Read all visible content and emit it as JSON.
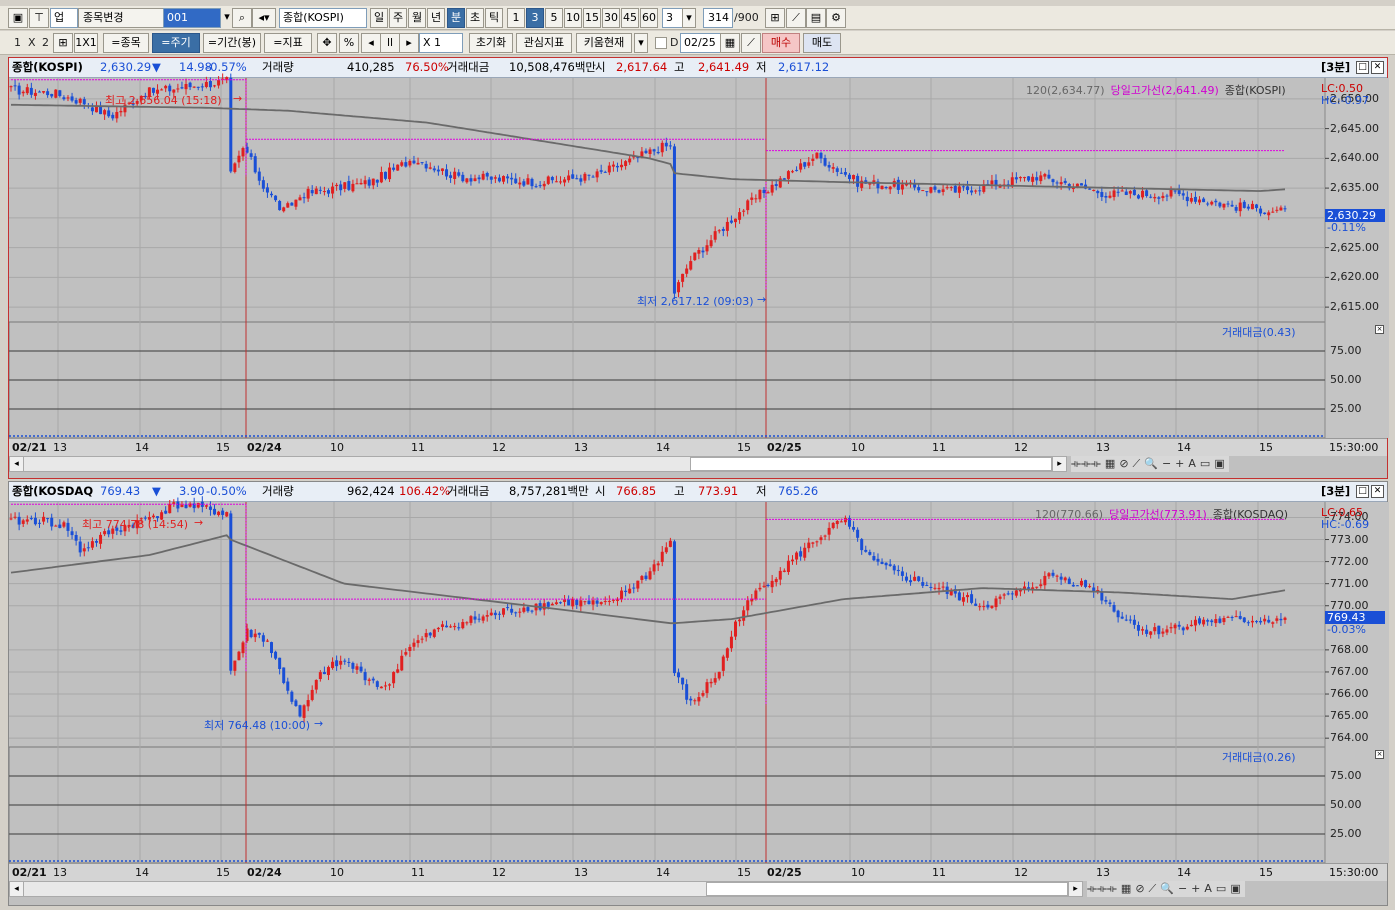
{
  "toolbar1": {
    "market": "업",
    "stock_change": "종목변경",
    "code": "001",
    "index_name": "종합(KOSPI)",
    "periods": [
      "일",
      "주",
      "월",
      "년",
      "분",
      "초",
      "틱"
    ],
    "intervals": [
      "1",
      "3",
      "5",
      "10",
      "15",
      "30",
      "45",
      "60"
    ],
    "interval_value": "3",
    "count": "314",
    "count_max": "/900"
  },
  "toolbar2": {
    "layout_1": "1",
    "layout_x": "X",
    "layout_2": "2",
    "layout_1x1": "1X1",
    "stock_btn": "=종목",
    "period_btn": "=주기",
    "range_btn": "=기간(봉)",
    "indicator_btn": "=지표",
    "percent": "%",
    "zoom": "X 1",
    "reset": "초기화",
    "interest": "관심지표",
    "kiwoom": "키움현재",
    "d_label": "D",
    "date": "02/25",
    "buy": "매수",
    "sell": "매도"
  },
  "colors": {
    "up": "#e02020",
    "down": "#1a4fd6",
    "ma": "#6a6a6a",
    "hiline": "#e000e0"
  },
  "charts": [
    {
      "title": "종합(KOSPI)",
      "price": "2,630.29",
      "arrow": "▼",
      "change": "14.98",
      "pct": "-0.57%",
      "vol_label": "거래량",
      "vol": "410,285",
      "vol_pct": "76.50%",
      "amt_label": "거래대금",
      "amt": "10,508,476백만",
      "open_label": "시",
      "open": "2,617.64",
      "high_label": "고",
      "high": "2,641.49",
      "low_label": "저",
      "low": "2,617.12",
      "interval_tag": "[3분]",
      "legend_ma": "120(2,634.77)",
      "legend_hi": "당일고가선(2,641.49)",
      "legend_name": "종합(KOSPI)",
      "lc": "LC:0.50",
      "hc": "HC:-0.97",
      "yticks": [
        "2,650.00",
        "2,645.00",
        "2,640.00",
        "2,635.00",
        "2,630.00",
        "2,625.00",
        "2,620.00",
        "2,615.00"
      ],
      "cur_price": "2,630.29",
      "cur_pct": "-0.11%",
      "max_label": "최고 2,656.04 (15:18)",
      "min_label": "최저 2,617.12 (09:03)",
      "sub_label": "거래대금(0.43)",
      "sub_ticks": [
        "75.00",
        "50.00",
        "25.00"
      ],
      "xlabels": [
        "02/21",
        "13",
        "14",
        "15",
        "02/24",
        "10",
        "11",
        "12",
        "13",
        "14",
        "15",
        "02/25",
        "10",
        "11",
        "12",
        "13",
        "14",
        "15"
      ],
      "time": "15:30:00"
    },
    {
      "title": "종합(KOSDAQ",
      "price": "769.43",
      "arrow": "▼",
      "change": "3.90",
      "pct": "-0.50%",
      "vol_label": "거래량",
      "vol": "962,424",
      "vol_pct": "106.42%",
      "amt_label": "거래대금",
      "amt": "8,757,281백만",
      "open_label": "시",
      "open": "766.85",
      "high_label": "고",
      "high": "773.91",
      "low_label": "저",
      "low": "765.26",
      "interval_tag": "[3분]",
      "legend_ma": "120(770.66)",
      "legend_hi": "당일고가선(773.91)",
      "legend_name": "종합(KOSDAQ)",
      "lc": "LC:0.65",
      "hc": "HC:-0.69",
      "yticks": [
        "774.00",
        "773.00",
        "772.00",
        "771.00",
        "770.00",
        "768.00",
        "767.00",
        "766.00",
        "765.00",
        "764.00"
      ],
      "cur_price": "769.43",
      "cur_pct": "-0.03%",
      "max_label": "최고 774.78 (14:54)",
      "min_label": "최저 764.48 (10:00)",
      "sub_label": "거래대금(0.26)",
      "sub_ticks": [
        "75.00",
        "50.00",
        "25.00"
      ],
      "xlabels": [
        "02/21",
        "13",
        "14",
        "15",
        "02/24",
        "10",
        "11",
        "12",
        "13",
        "14",
        "15",
        "02/25",
        "10",
        "11",
        "12",
        "13",
        "14",
        "15"
      ],
      "time": "15:30:00"
    }
  ]
}
